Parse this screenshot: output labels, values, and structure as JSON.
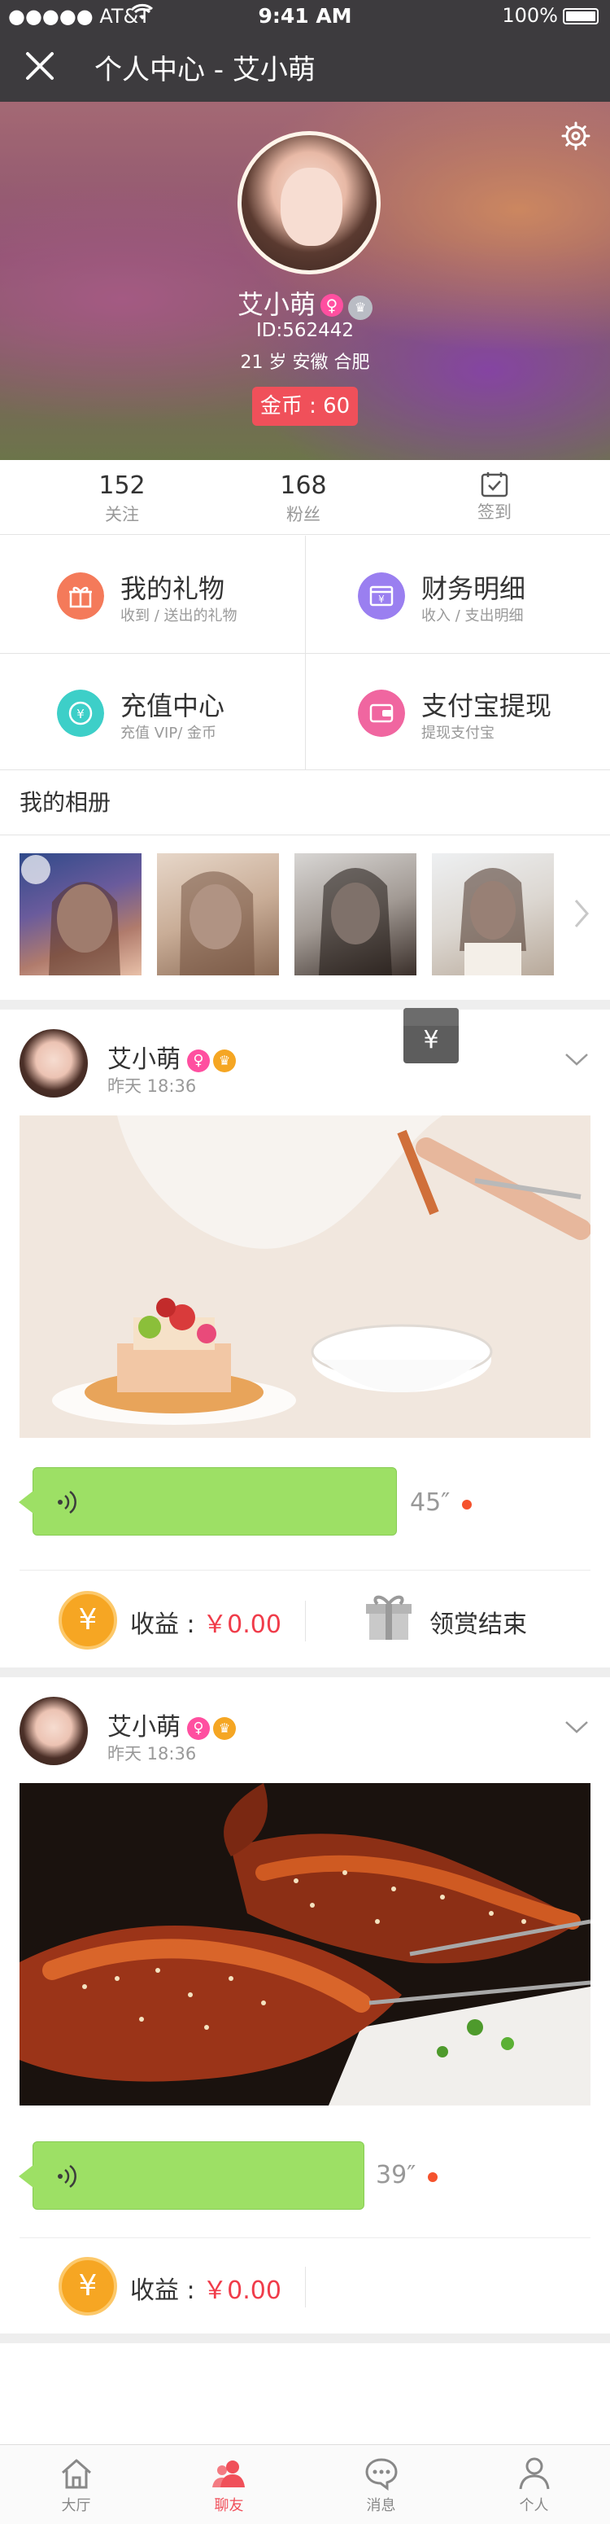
{
  "status_bar": {
    "carrier": "●●●●● AT&T",
    "time": "9:41 AM",
    "battery": "100%"
  },
  "nav": {
    "title": "个人中心 - 艾小萌"
  },
  "profile": {
    "name": "艾小萌",
    "gender_symbol": "♀",
    "id_text": "ID:562442",
    "info": "21 岁  安徽 合肥",
    "coins": "金币 : 60"
  },
  "stats": [
    {
      "value": "152",
      "label": "关注"
    },
    {
      "value": "168",
      "label": "粉丝"
    },
    {
      "value": "",
      "label": "签到"
    }
  ],
  "menu": [
    {
      "title": "我的礼物",
      "subtitle": "收到 / 送出的礼物",
      "icon": "gift-icon",
      "color": "#f47a5a"
    },
    {
      "title": "财务明细",
      "subtitle": "收入 / 支出明细",
      "icon": "wallet-icon",
      "color": "#9a7ff0"
    },
    {
      "title": "充值中心",
      "subtitle": "充值 VIP/ 金币",
      "icon": "recharge-icon",
      "color": "#3dcfc8"
    },
    {
      "title": "支付宝提现",
      "subtitle": "提现支付宝",
      "icon": "alipay-icon",
      "color": "#f066a0"
    }
  ],
  "album": {
    "title": "我的相册"
  },
  "posts": [
    {
      "name": "艾小萌",
      "time": "昨天 18:36",
      "duration": "45″",
      "earnings_label": "收益 : ",
      "earnings_amount": "￥0.00",
      "reward_status": "领赏结束"
    },
    {
      "name": "艾小萌",
      "time": "昨天 18:36",
      "duration": "39″",
      "earnings_label": "收益 : ",
      "earnings_amount": "￥0.00"
    }
  ],
  "tabs": [
    {
      "label": "大厅",
      "active": false
    },
    {
      "label": "聊友",
      "active": true
    },
    {
      "label": "消息",
      "active": false
    },
    {
      "label": "个人",
      "active": false
    }
  ],
  "colors": {
    "accent": "#f0505a",
    "voice": "#9de065",
    "coin": "#f6a623"
  }
}
